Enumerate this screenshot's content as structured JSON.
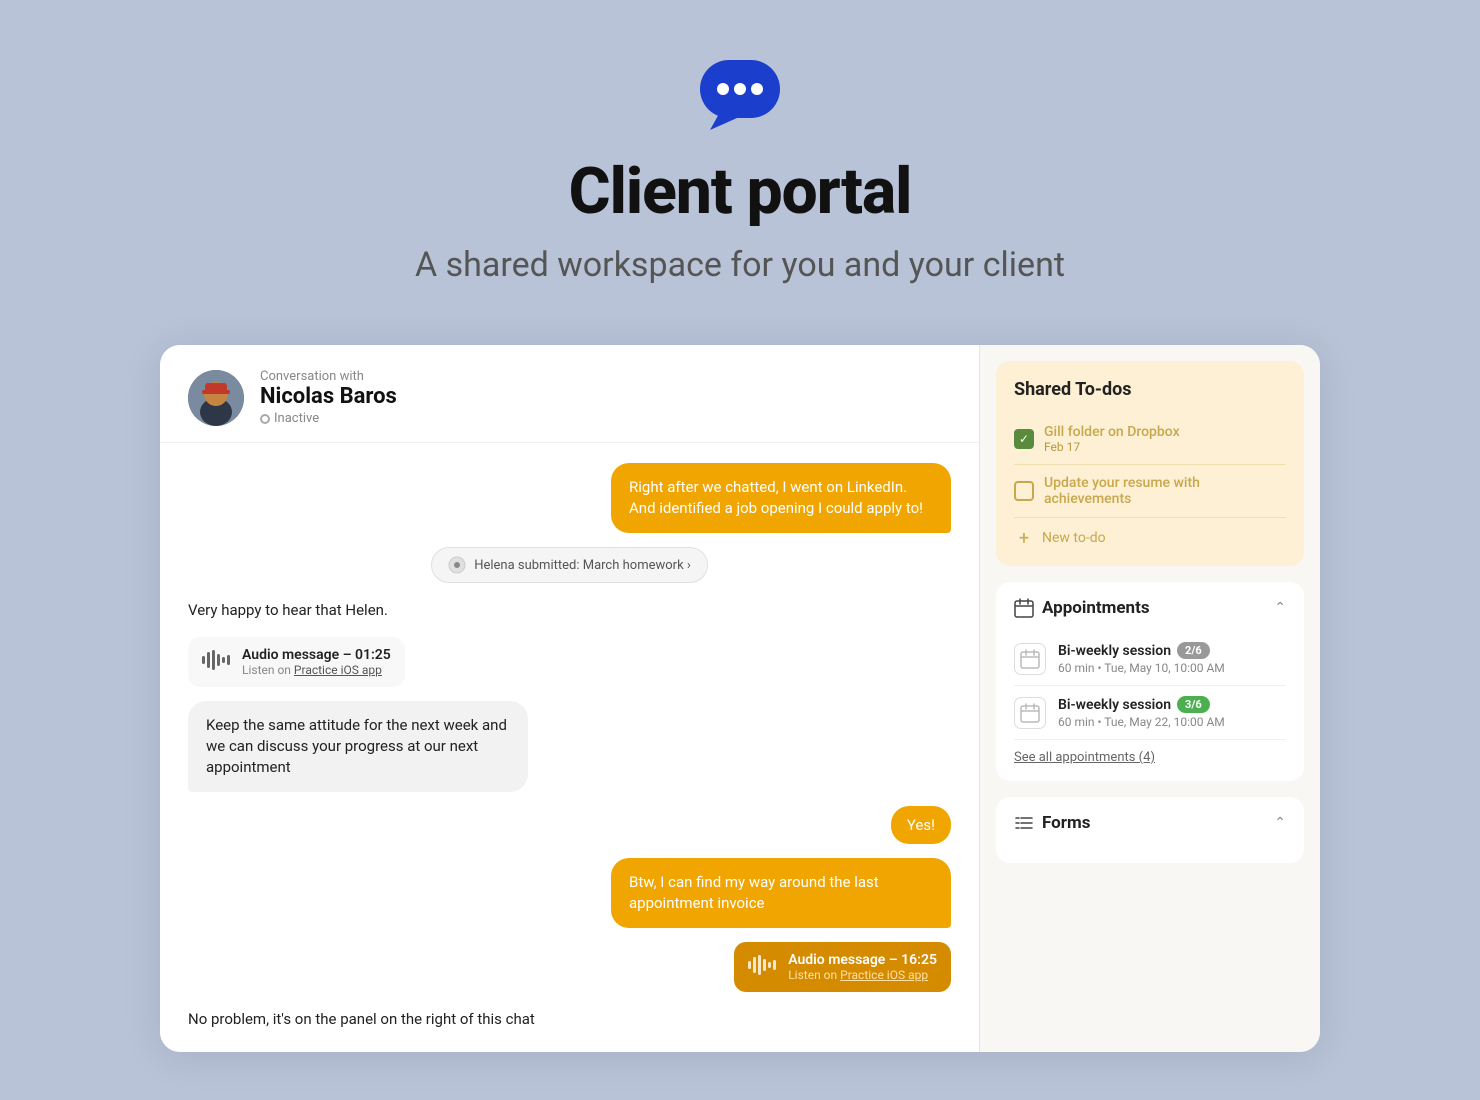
{
  "hero": {
    "title": "Client portal",
    "subtitle": "A shared workspace for you and your client"
  },
  "chat": {
    "header_label": "Conversation with",
    "client_name": "Nicolas Baros",
    "status": "Inactive",
    "messages": [
      {
        "type": "right",
        "text": "Right after we chatted, I went on LinkedIn. And identified a job opening I could apply to!"
      },
      {
        "type": "system",
        "text": "Helena submitted: March homework ›"
      },
      {
        "type": "plain-left",
        "text": "Very happy to hear that Helen."
      },
      {
        "type": "audio-left",
        "title": "Audio message – 01:25",
        "sub": "Listen on Practice iOS app"
      },
      {
        "type": "plain-left",
        "text": "Keep the same attitude for the next week and we can discuss your progress at our next appointment"
      },
      {
        "type": "small-right",
        "text": "Yes!"
      },
      {
        "type": "right",
        "text": "Btw, I can find my way around the last appointment invoice"
      },
      {
        "type": "audio-right",
        "title": "Audio message – 16:25",
        "sub": "Listen on Practice iOS app"
      },
      {
        "type": "plain-left",
        "text": "No problem, it's on the panel on the right of this chat"
      }
    ]
  },
  "todos": {
    "title": "Shared To-dos",
    "items": [
      {
        "text": "Gill folder on Dropbox",
        "date": "Feb 17",
        "checked": true
      },
      {
        "text": "Update your resume with achievements",
        "checked": false
      }
    ],
    "add_label": "New to-do"
  },
  "appointments": {
    "title": "Appointments",
    "items": [
      {
        "title": "Bi-weekly session",
        "badge": "2/6",
        "badge_type": "gray",
        "meta": "60 min  •  Tue, May 10, 10:00 AM"
      },
      {
        "title": "Bi-weekly session",
        "badge": "3/6",
        "badge_type": "green",
        "meta": "60 min  •  Tue, May 22, 10:00 AM"
      }
    ],
    "see_all": "See all appointments (4)"
  },
  "forms": {
    "title": "Forms"
  }
}
